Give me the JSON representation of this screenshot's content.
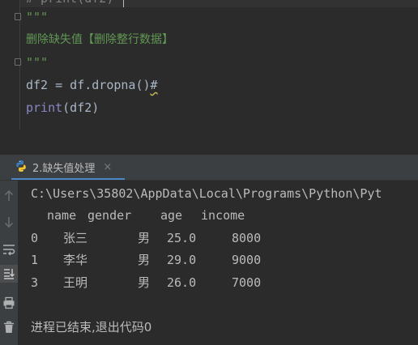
{
  "editor": {
    "cut_line": "# print(df2)",
    "docstring_open": "\"\"\"",
    "docstring_text": "删除缺失值【删除整行数据】",
    "docstring_close": "\"\"\"",
    "code_assign_prefix": "df2 = df.",
    "code_assign_call": "dropna()",
    "code_assign_hash": "#",
    "code_print_func": "print",
    "code_print_args": "(df2)"
  },
  "run_panel": {
    "tab_label": "2.缺失值处理",
    "tab_close": "×",
    "tab_icon": "python-icon"
  },
  "console": {
    "path_line": "C:\\Users\\35802\\AppData\\Local\\Programs\\Python\\Pyt",
    "headers": [
      "name",
      "gender",
      "age",
      "income"
    ],
    "rows": [
      {
        "index": "0",
        "name": "张三",
        "gender": "男",
        "age": "25.0",
        "income": "8000"
      },
      {
        "index": "1",
        "name": "李华",
        "gender": "男",
        "age": "29.0",
        "income": "9000"
      },
      {
        "index": "3",
        "name": "王明",
        "gender": "男",
        "age": "26.0",
        "income": "7000"
      }
    ],
    "exit_message": "进程已结束,退出代码0"
  },
  "toolbar": {
    "icons": [
      "up-arrow-icon",
      "down-arrow-icon",
      "soft-wrap-icon",
      "scroll-to-end-icon",
      "print-icon",
      "trash-icon"
    ]
  },
  "colors": {
    "background": "#2b2b2b",
    "docstring": "#629755",
    "builtin": "#8888c6",
    "text": "#a9b7c6",
    "tab_accent": "#4a88c7"
  }
}
